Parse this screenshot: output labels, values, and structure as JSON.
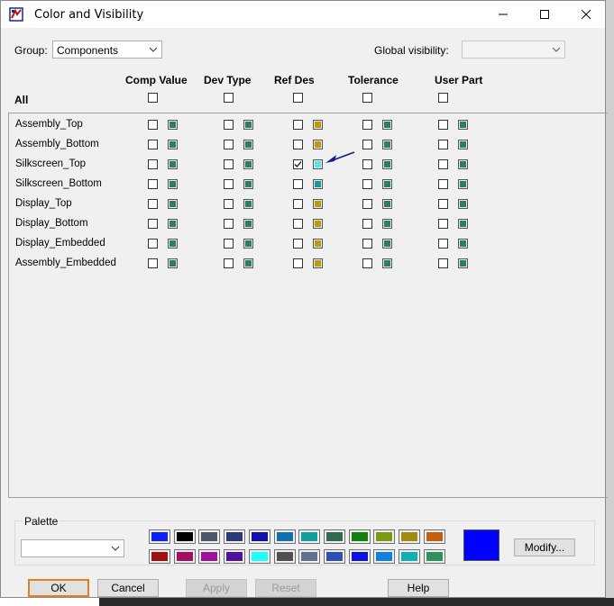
{
  "window": {
    "title": "Color and Visibility"
  },
  "group": {
    "label": "Group:",
    "value": "Components"
  },
  "global_visibility": {
    "label": "Global visibility:",
    "value": ""
  },
  "columns": [
    {
      "label": "Comp Value"
    },
    {
      "label": "Dev Type"
    },
    {
      "label": "Ref Des"
    },
    {
      "label": "Tolerance"
    },
    {
      "label": "User Part"
    }
  ],
  "all_label": "All",
  "rows": [
    {
      "label": "Assembly_Top",
      "cells": [
        {
          "checked": false,
          "color": "#2e7d5b"
        },
        {
          "checked": false,
          "color": "#2e7d5b"
        },
        {
          "checked": false,
          "color": "#b89b10"
        },
        {
          "checked": false,
          "color": "#2e7d5b"
        },
        {
          "checked": false,
          "color": "#2e7d5b"
        }
      ]
    },
    {
      "label": "Assembly_Bottom",
      "cells": [
        {
          "checked": false,
          "color": "#2e7d5b"
        },
        {
          "checked": false,
          "color": "#2e7d5b"
        },
        {
          "checked": false,
          "color": "#b89b10"
        },
        {
          "checked": false,
          "color": "#2e7d5b"
        },
        {
          "checked": false,
          "color": "#2e7d5b"
        }
      ]
    },
    {
      "label": "Silkscreen_Top",
      "cells": [
        {
          "checked": false,
          "color": "#2e7d5b"
        },
        {
          "checked": false,
          "color": "#2e7d5b"
        },
        {
          "checked": true,
          "color": "#5fe0e6"
        },
        {
          "checked": false,
          "color": "#2e7d5b"
        },
        {
          "checked": false,
          "color": "#2e7d5b"
        }
      ]
    },
    {
      "label": "Silkscreen_Bottom",
      "cells": [
        {
          "checked": false,
          "color": "#2e7d5b"
        },
        {
          "checked": false,
          "color": "#2e7d5b"
        },
        {
          "checked": false,
          "color": "#1a9a9a"
        },
        {
          "checked": false,
          "color": "#2e7d5b"
        },
        {
          "checked": false,
          "color": "#2e7d5b"
        }
      ]
    },
    {
      "label": "Display_Top",
      "cells": [
        {
          "checked": false,
          "color": "#2e7d5b"
        },
        {
          "checked": false,
          "color": "#2e7d5b"
        },
        {
          "checked": false,
          "color": "#b89b10"
        },
        {
          "checked": false,
          "color": "#2e7d5b"
        },
        {
          "checked": false,
          "color": "#2e7d5b"
        }
      ]
    },
    {
      "label": "Display_Bottom",
      "cells": [
        {
          "checked": false,
          "color": "#2e7d5b"
        },
        {
          "checked": false,
          "color": "#2e7d5b"
        },
        {
          "checked": false,
          "color": "#b89b10"
        },
        {
          "checked": false,
          "color": "#2e7d5b"
        },
        {
          "checked": false,
          "color": "#2e7d5b"
        }
      ]
    },
    {
      "label": "Display_Embedded",
      "cells": [
        {
          "checked": false,
          "color": "#2e7d5b"
        },
        {
          "checked": false,
          "color": "#2e7d5b"
        },
        {
          "checked": false,
          "color": "#b89b10"
        },
        {
          "checked": false,
          "color": "#2e7d5b"
        },
        {
          "checked": false,
          "color": "#2e7d5b"
        }
      ]
    },
    {
      "label": "Assembly_Embedded",
      "cells": [
        {
          "checked": false,
          "color": "#2e7d5b"
        },
        {
          "checked": false,
          "color": "#2e7d5b"
        },
        {
          "checked": false,
          "color": "#b89b10"
        },
        {
          "checked": false,
          "color": "#2e7d5b"
        },
        {
          "checked": false,
          "color": "#2e7d5b"
        }
      ]
    }
  ],
  "palette": {
    "label": "Palette",
    "dropdown_value": "",
    "colors_row1": [
      "#0a20ff",
      "#000000",
      "#4a5a6a",
      "#2a3a7a",
      "#1010b0",
      "#1070b0",
      "#10a0a0",
      "#306a50",
      "#108010",
      "#7a9a10",
      "#a08a10",
      "#c06010"
    ],
    "colors_row2": [
      "#a01010",
      "#a01060",
      "#a010a0",
      "#5010a0",
      "#20ffff",
      "#505050",
      "#607090",
      "#3050b0",
      "#1010e0",
      "#1080e0",
      "#10b0b0",
      "#309060"
    ],
    "selected_color": "#0000ff",
    "modify_label": "Modify..."
  },
  "buttons": {
    "ok": "OK",
    "cancel": "Cancel",
    "apply": "Apply",
    "reset": "Reset",
    "help": "Help"
  },
  "icons": {
    "minimize": "minimize-icon",
    "maximize": "maximize-icon",
    "close": "close-icon",
    "arrow": "arrow-annotation-icon"
  }
}
